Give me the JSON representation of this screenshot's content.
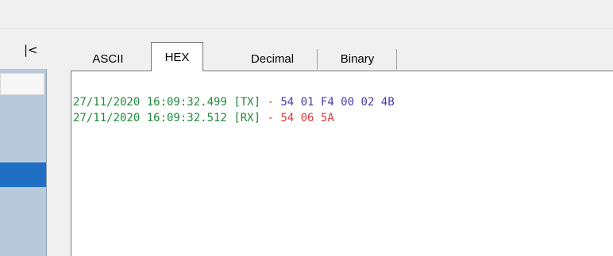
{
  "toolbar": {
    "collapse_label": "|<"
  },
  "tabs": [
    {
      "label": "ASCII",
      "active": false
    },
    {
      "label": "HEX",
      "active": true
    },
    {
      "label": "Decimal",
      "active": false
    },
    {
      "label": "Binary",
      "active": false
    }
  ],
  "log": [
    {
      "timestamp": "27/11/2020 16:09:32.499",
      "direction": "[TX]",
      "separator": " - ",
      "bytes": "54 01 F4 00 02 4B"
    },
    {
      "timestamp": "27/11/2020 16:09:32.512",
      "direction": "[RX]",
      "separator": " - ",
      "bytes": "54 06 5A"
    }
  ],
  "colors": {
    "timestamp": "#1f8a3b",
    "tx_bytes": "#4b3aa8",
    "rx_bytes": "#d83a3a",
    "selected_item": "#1f6fc5"
  }
}
